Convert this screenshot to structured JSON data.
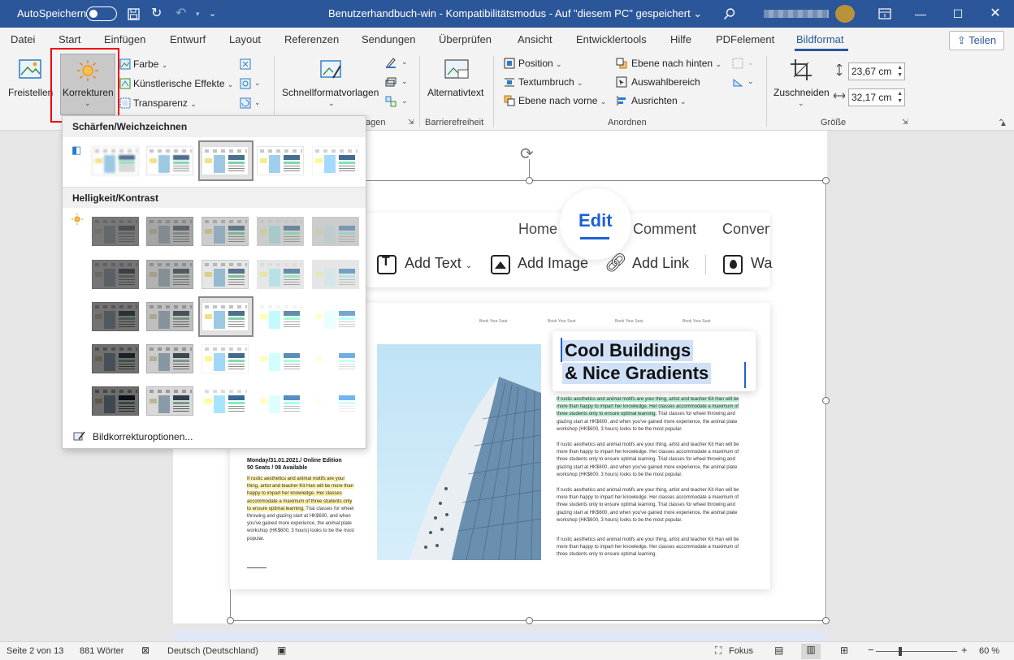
{
  "titlebar": {
    "autosave_label": "AutoSpeichern",
    "doc_title": "Benutzerhandbuch-win  -  Kompatibilitätsmodus  -  Auf \"diesem PC\" gespeichert  ⌄"
  },
  "tabs": [
    "Datei",
    "Start",
    "Einfügen",
    "Entwurf",
    "Layout",
    "Referenzen",
    "Sendungen",
    "Überprüfen",
    "Ansicht",
    "Entwicklertools",
    "Hilfe",
    "PDFelement",
    "Bildformat"
  ],
  "active_tab": "Bildformat",
  "share_label": "Teilen",
  "ribbon": {
    "freistellen": "Freistellen",
    "korrekturen": "Korrekturen",
    "farbe": "Farbe",
    "kuenstlerische": "Künstlerische Effekte",
    "transparenz": "Transparenz",
    "schnellformat": "Schnellformatvorlagen",
    "alternativtext": "Alternativtext",
    "position": "Position",
    "textumbruch": "Textumbruch",
    "ebene_vorne": "Ebene nach vorne",
    "ebene_hinten": "Ebene nach hinten",
    "auswahlbereich": "Auswahlbereich",
    "ausrichten": "Ausrichten",
    "zuschneiden": "Zuschneiden",
    "height_value": "23,67 cm",
    "width_value": "32,17 cm",
    "group_vorlagen_tail": "agen",
    "group_barrierefreiheit": "Barrierefreiheit",
    "group_anordnen": "Anordnen",
    "group_groesse": "Größe"
  },
  "panel": {
    "section1": "Schärfen/Weichzeichnen",
    "section2": "Helligkeit/Kontrast",
    "options_link": "Bildkorrekturoptionen..."
  },
  "embedded": {
    "nav_home": "Home",
    "nav_edit": "Edit",
    "nav_comment": "Comment",
    "nav_convert": "Convert",
    "tool_text": "Add Text",
    "tool_image": "Add Image",
    "tool_link": "Add Link",
    "tool_wa": "Wa",
    "book_seat": "Book Your Seat",
    "title_line1": "Cool Buildings",
    "title_line2": "& Nice Gradients",
    "para_green": "If rustic aesthetics and animal motifs are your thing, artist and teacher Kit Han will be more than happy to impart her knowledge. Her classes accommodate a maximum of three students only to ensure optimal learning.",
    "para_green_tail": " Trial classes for wheel throwing and glazing start at HK$600, and when you've gained more experience, the animal plate workshop (HK$600, 3 hours) looks to be the most popular.",
    "para_body": "If rustic aesthetics and animal motifs are your thing, artist and teacher Kit Han will be more than happy to impart her knowledge. Her classes accommodate a maximum of three students only to ensure optimal learning. Trial classes for wheel throwing and glazing start at HK$600, and when you've gained more experience, the animal plate workshop (HK$600, 3 hours) looks to be the most popular.",
    "para_short": "If rustic aesthetics and animal motifs are your thing, artist and teacher Kit Han will be more than happy to impart her knowledge. Her classes accommodate a maximum of three students only to ensure optimal learning.",
    "left_head1": "Monday/31.01.2021./ Online Edition",
    "left_head2": "50 Seats / 08 Available",
    "left_yellow": "If rustic aesthetics and animal motifs are your thing, artist and teacher Kit Han will be more than happy to impart her knowledge. Her classes accommodate a maximum of three students only to ensure optimal learning.",
    "left_tail": " Trial classes for wheel throwing and glazing start at HK$600, and when you've gained more experience, the animal plate workshop (HK$600, 3 hours) looks to be the most popular."
  },
  "status": {
    "page": "Seite 2 von 13",
    "words": "881 Wörter",
    "language": "Deutsch (Deutschland)",
    "focus": "Fokus",
    "zoom_minus": "−",
    "zoom_plus": "+",
    "zoom": "60 %"
  },
  "colors": {
    "titlebar": "#2b579a",
    "edit_blue": "#1e60d6",
    "highlight_green": "#b8ecd2",
    "highlight_yellow": "#fff1a6",
    "red_frame": "#e00000"
  }
}
